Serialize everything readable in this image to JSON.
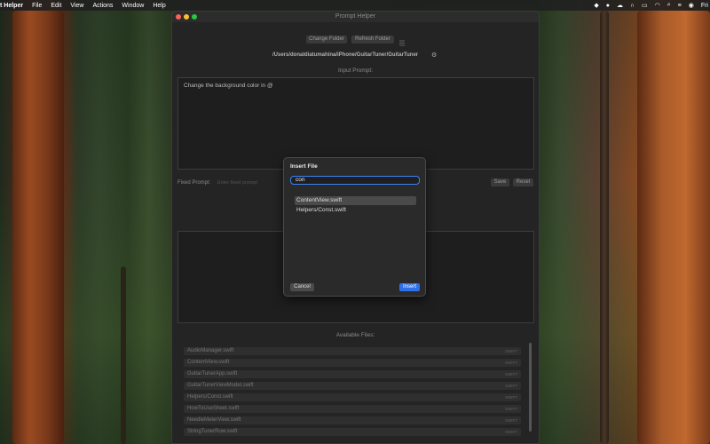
{
  "menubar": {
    "app_name": "t Helper",
    "items": [
      "File",
      "Edit",
      "View",
      "Actions",
      "Window",
      "Help"
    ],
    "clock": "Fri"
  },
  "window": {
    "title": "Prompt Helper",
    "change_folder": "Change Folder",
    "refresh_folder": "Refresh Folder",
    "path": "/Users/donaldiatumahina/iPhone/GuitarTuner/GuitarTuner",
    "input_prompt_label": "Input Prompt:",
    "input_prompt_text": "Change the background color in @",
    "fixed_prompt_label": "Fixed Prompt:",
    "fixed_prompt_placeholder": "Enter fixed prompt",
    "save": "Save",
    "reset": "Reset",
    "available_files_label": "Available Files:",
    "files": [
      {
        "name": "AudioManager.swift",
        "ext": "SWIFT"
      },
      {
        "name": "ContentView.swift",
        "ext": "SWIFT"
      },
      {
        "name": "GuitarTunerApp.swift",
        "ext": "SWIFT"
      },
      {
        "name": "GuitarTunerViewModel.swift",
        "ext": "SWIFT"
      },
      {
        "name": "Helpers/Const.swift",
        "ext": "SWIFT"
      },
      {
        "name": "HowToUseSheet.swift",
        "ext": "SWIFT"
      },
      {
        "name": "NeedleMeterView.swift",
        "ext": "SWIFT"
      },
      {
        "name": "StringTunerRow.swift",
        "ext": "SWIFT"
      }
    ]
  },
  "dialog": {
    "title": "Insert File",
    "search_value": "con",
    "results": [
      "ContentView.swift",
      "Helpers/Const.swift"
    ],
    "cancel": "Cancel",
    "insert": "Insert"
  },
  "colors": {
    "accent": "#2f6fe8",
    "close": "#ff5f57",
    "minimize": "#febc2e",
    "zoom": "#28c840"
  }
}
